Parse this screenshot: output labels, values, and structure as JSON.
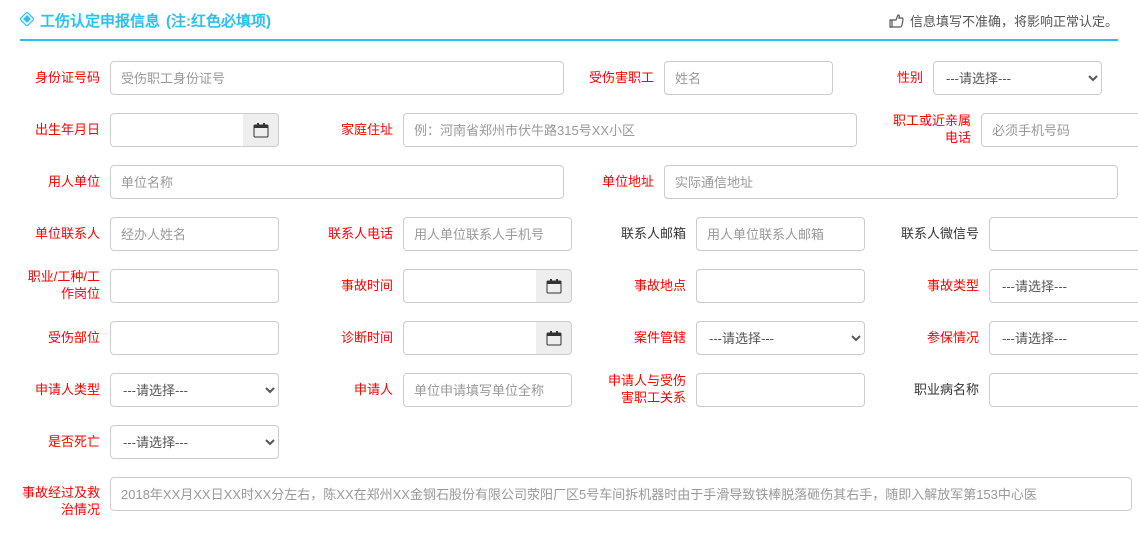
{
  "header": {
    "title": "工伤认定申报信息",
    "note": "(注:红色必填项)",
    "hint": "信息填写不准确，将影响正常认定。"
  },
  "labels": {
    "idNumber": "身份证号码",
    "injuredWorker": "受伤害职工",
    "gender": "性别",
    "birthDate": "出生年月日",
    "homeAddress": "家庭住址",
    "relativePhone": "职工或近亲属电话",
    "employer": "用人单位",
    "employerAddress": "单位地址",
    "contactPerson": "单位联系人",
    "contactPhone": "联系人电话",
    "contactEmail": "联系人邮箱",
    "contactWechat": "联系人微信号",
    "occupation": "职业/工种/工作岗位",
    "accidentTime": "事故时间",
    "accidentLocation": "事故地点",
    "accidentType": "事故类型",
    "injuryPart": "受伤部位",
    "diagnosisTime": "诊断时间",
    "caseJurisdiction": "案件管辖",
    "insuranceStatus": "参保情况",
    "applicantType": "申请人类型",
    "applicant": "申请人",
    "applicantRelation": "申请人与受伤害职工关系",
    "diseaseName": "职业病名称",
    "isDeath": "是否死亡",
    "accidentDesc": "事故经过及救治情况"
  },
  "placeholders": {
    "idNumber": "受伤职工身份证号",
    "injuredWorker": "姓名",
    "homeAddress": "例：河南省郑州市伏牛路315号XX小区",
    "relativePhone": "必须手机号码",
    "employer": "单位名称",
    "employerAddress": "实际通信地址",
    "contactPerson": "经办人姓名",
    "contactPhone": "用人单位联系人手机号",
    "contactEmail": "用人单位联系人邮箱",
    "applicant": "单位申请填写单位全称",
    "accidentDesc": "2018年XX月XX日XX时XX分左右，陈XX在郑州XX金钢石股份有限公司荥阳厂区5号车间拆机器时由于手滑导致铁棒脱落砸伤其右手，随即入解放军第153中心医"
  },
  "options": {
    "pleaseSelect": "---请选择---"
  }
}
